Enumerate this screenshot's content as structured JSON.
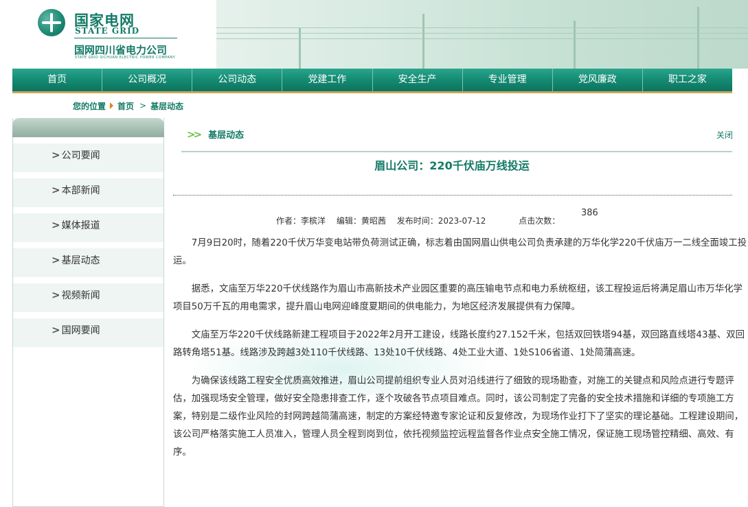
{
  "header": {
    "logo_cn": "国家电网",
    "logo_en": "STATE GRID",
    "company_cn": "国网四川省电力公司",
    "company_en": "STATE GRID SICHUAN ELECTRIC POWER COMPANY"
  },
  "nav": {
    "items": [
      "首页",
      "公司概况",
      "公司动态",
      "党建工作",
      "安全生产",
      "专业管理",
      "党风廉政",
      "职工之家"
    ]
  },
  "breadcrumb": {
    "label": "您的位置",
    "home": "首页",
    "current": "基层动态"
  },
  "sidebar": {
    "items": [
      "公司要闻",
      "本部新闻",
      "媒体报道",
      "基层动态",
      "视频新闻",
      "国网要闻"
    ]
  },
  "content": {
    "section_title": "基层动态",
    "close_label": "关闭",
    "article_title": "眉山公司：220千伏庙万线投运",
    "meta": {
      "author": "作者：李槟洋",
      "editor": "编辑：黄昭茜",
      "date": "发布时间：2023-07-12",
      "hits_label": "点击次数：",
      "hits_value": "386"
    },
    "paragraphs": [
      "7月9日20时，随着220千伏万华变电站带负荷测试正确，标志着由国网眉山供电公司负责承建的万华化学220千伏庙万一二线全面竣工投运。",
      "据悉，文庙至万华220千伏线路作为眉山市高新技术产业园区重要的高压输电节点和电力系统枢纽，该工程投运后将满足眉山市万华化学项目50万千瓦的用电需求，提升眉山电网迎峰度夏期间的供电能力，为地区经济发展提供有力保障。",
      "文庙至万华220千伏线路新建工程项目于2022年2月开工建设，线路长度约27.152千米，包括双回铁塔94基，双回路直线塔43基、双回路转角塔51基。线路涉及跨越3处110千伏线路、13处10千伏线路、4处工业大道、1处S106省道、1处简蒲高速。",
      "为确保该线路工程安全优质高效推进，眉山公司提前组织专业人员对沿线进行了细致的现场勘查，对施工的关键点和风险点进行专题评估，加强现场安全管理，做好安全隐患排查工作，逐个攻破各节点项目难点。同时，该公司制定了完备的安全技术措施和详细的专项施工方案，特别是二级作业风险的封网跨越简蒲高速，制定的方案经特邀专家论证和反复修改，为现场作业打下了坚实的理论基础。工程建设期间，该公司严格落实施工人员准入，管理人员全程到岗到位，依托视频监控远程监督各作业点安全施工情况，保证施工现场管控精细、高效、有序。"
    ]
  }
}
